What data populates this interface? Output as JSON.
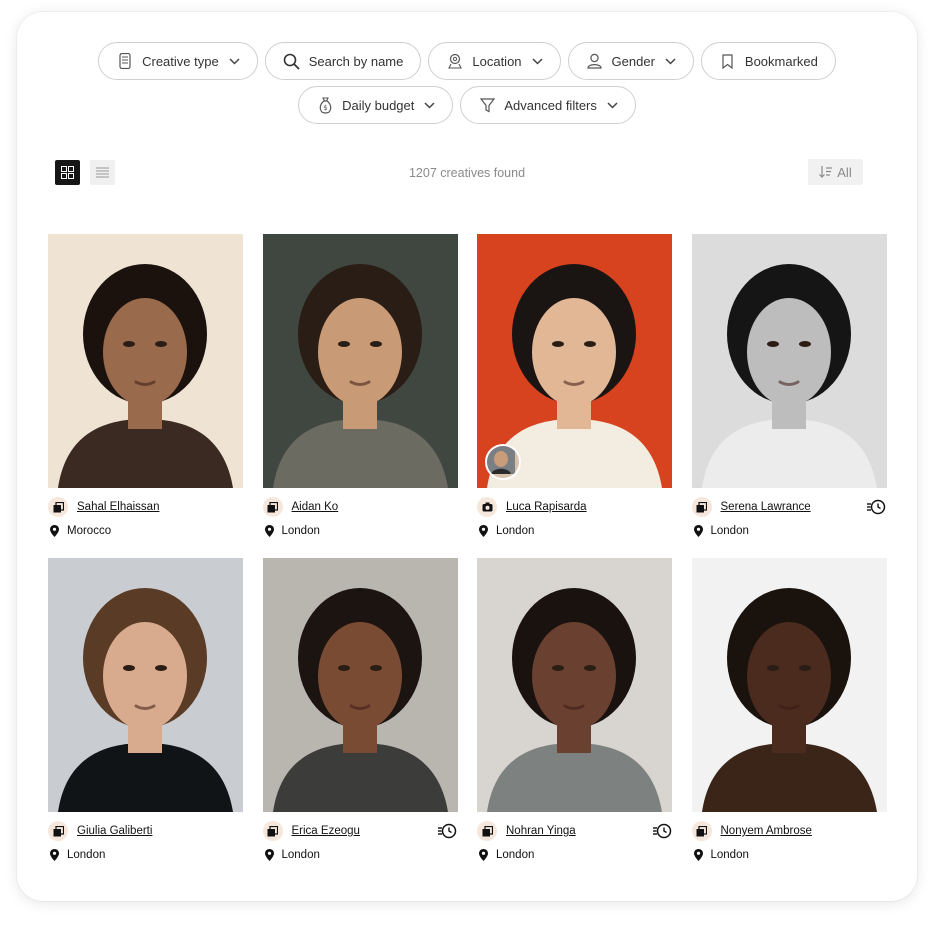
{
  "filters": {
    "row1": [
      {
        "label": "Creative type",
        "icon": "mobile-icon",
        "has_dropdown": true
      },
      {
        "label": "Search by name",
        "icon": "search-icon",
        "has_dropdown": false
      },
      {
        "label": "Location",
        "icon": "map-pin-icon",
        "has_dropdown": true
      },
      {
        "label": "Gender",
        "icon": "person-icon",
        "has_dropdown": true
      },
      {
        "label": "Bookmarked",
        "icon": "bookmark-icon",
        "has_dropdown": false
      }
    ],
    "row2": [
      {
        "label": "Daily budget",
        "icon": "money-bag-icon",
        "has_dropdown": true
      },
      {
        "label": "Advanced filters",
        "icon": "funnel-icon",
        "has_dropdown": true
      }
    ]
  },
  "toolbar": {
    "results_count": "1207 creatives found",
    "sort_label": "All",
    "active_view": "grid"
  },
  "creatives": [
    {
      "name": "Sahal Elhaissan",
      "location": "Morocco",
      "type_icon": "gallery-icon",
      "express": false,
      "photo_bg": "#efe4d4",
      "skin": "#9a6a4c",
      "hair": "#1b120d",
      "top": "#3a2a22",
      "mini_avatar": false
    },
    {
      "name": "Aidan Ko",
      "location": "London",
      "type_icon": "gallery-icon",
      "express": false,
      "photo_bg": "#3f4740",
      "skin": "#c89a76",
      "hair": "#2a1d16",
      "top": "#6b6b62",
      "mini_avatar": false
    },
    {
      "name": "Luca Rapisarda",
      "location": "London",
      "type_icon": "camera-icon",
      "express": false,
      "photo_bg": "#d7421f",
      "skin": "#e2b795",
      "hair": "#1a1412",
      "top": "#f3ece0",
      "mini_avatar": true
    },
    {
      "name": "Serena Lawrance",
      "location": "London",
      "type_icon": "gallery-icon",
      "express": true,
      "photo_bg": "#dcdcdc",
      "skin": "#bdbdbd",
      "hair": "#151515",
      "top": "#ececec",
      "mini_avatar": false
    },
    {
      "name": "Giulia Galiberti",
      "location": "London",
      "type_icon": "gallery-icon",
      "express": false,
      "photo_bg": "#c9ccd0",
      "skin": "#d9ab8e",
      "hair": "#5a3b26",
      "top": "#111417",
      "mini_avatar": false
    },
    {
      "name": "Erica Ezeogu",
      "location": "London",
      "type_icon": "gallery-icon",
      "express": true,
      "photo_bg": "#b9b6b0",
      "skin": "#7a4b33",
      "hair": "#1c1410",
      "top": "#3c3c3a",
      "mini_avatar": false
    },
    {
      "name": "Nohran Yinga",
      "location": "London",
      "type_icon": "gallery-icon",
      "express": true,
      "photo_bg": "#d8d4cf",
      "skin": "#6a4030",
      "hair": "#19120e",
      "top": "#7d8280",
      "mini_avatar": false
    },
    {
      "name": "Nonyem Ambrose",
      "location": "London",
      "type_icon": "gallery-icon",
      "express": false,
      "photo_bg": "#f2f2f2",
      "skin": "#4a2b1d",
      "hair": "#1a120d",
      "top": "#3b2519",
      "mini_avatar": false
    }
  ]
}
